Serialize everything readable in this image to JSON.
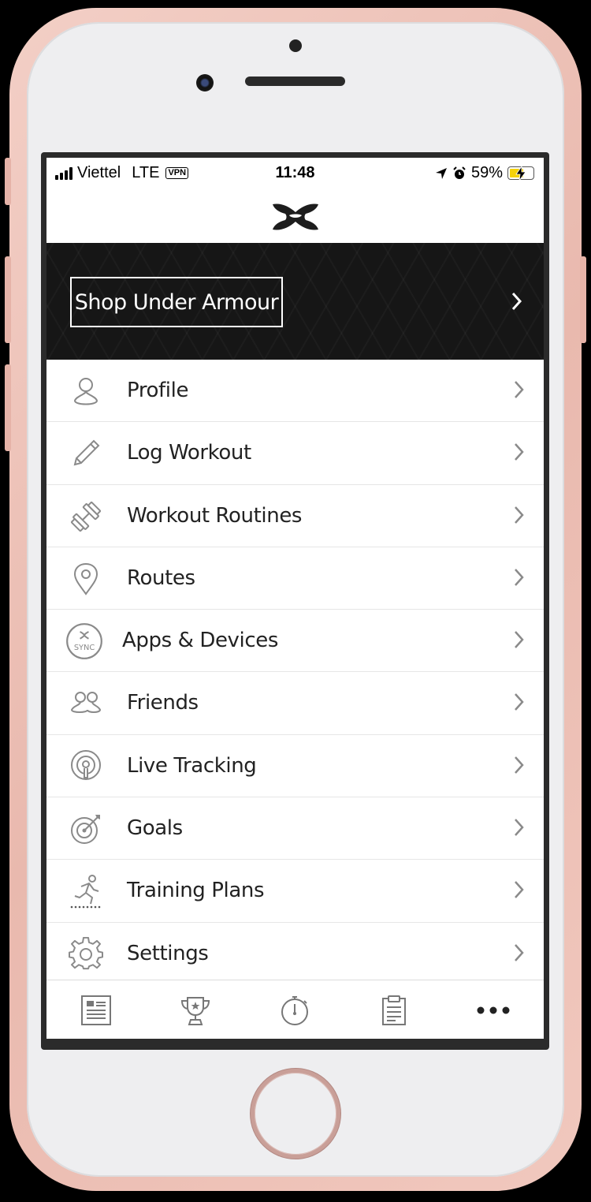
{
  "status_bar": {
    "carrier": "Viettel",
    "network": "LTE",
    "vpn": "VPN",
    "time": "11:48",
    "battery": "59%"
  },
  "banner": {
    "shop_label": "Shop Under Armour"
  },
  "menu": {
    "items": [
      {
        "label": "Profile",
        "icon": "person-icon"
      },
      {
        "label": "Log Workout",
        "icon": "pencil-icon"
      },
      {
        "label": "Workout Routines",
        "icon": "dumbbell-icon"
      },
      {
        "label": "Routes",
        "icon": "map-pin-icon"
      },
      {
        "label": "Apps & Devices",
        "icon": "sync-icon",
        "icon_text": "SYNC"
      },
      {
        "label": "Friends",
        "icon": "friends-icon"
      },
      {
        "label": "Live Tracking",
        "icon": "live-tracking-icon"
      },
      {
        "label": "Goals",
        "icon": "target-icon"
      },
      {
        "label": "Training Plans",
        "icon": "runner-icon"
      },
      {
        "label": "Settings",
        "icon": "gear-icon"
      }
    ]
  },
  "tab_bar": {
    "tabs": [
      {
        "name": "feed-tab",
        "icon": "feed-icon"
      },
      {
        "name": "challenges-tab",
        "icon": "trophy-icon"
      },
      {
        "name": "record-tab",
        "icon": "stopwatch-icon"
      },
      {
        "name": "plans-tab",
        "icon": "clipboard-icon"
      },
      {
        "name": "more-tab",
        "icon": "more-icon"
      }
    ]
  },
  "colors": {
    "phone_frame": "#f1c8be",
    "banner_bg": "#161616",
    "icon_gray": "#8a8a8a"
  }
}
